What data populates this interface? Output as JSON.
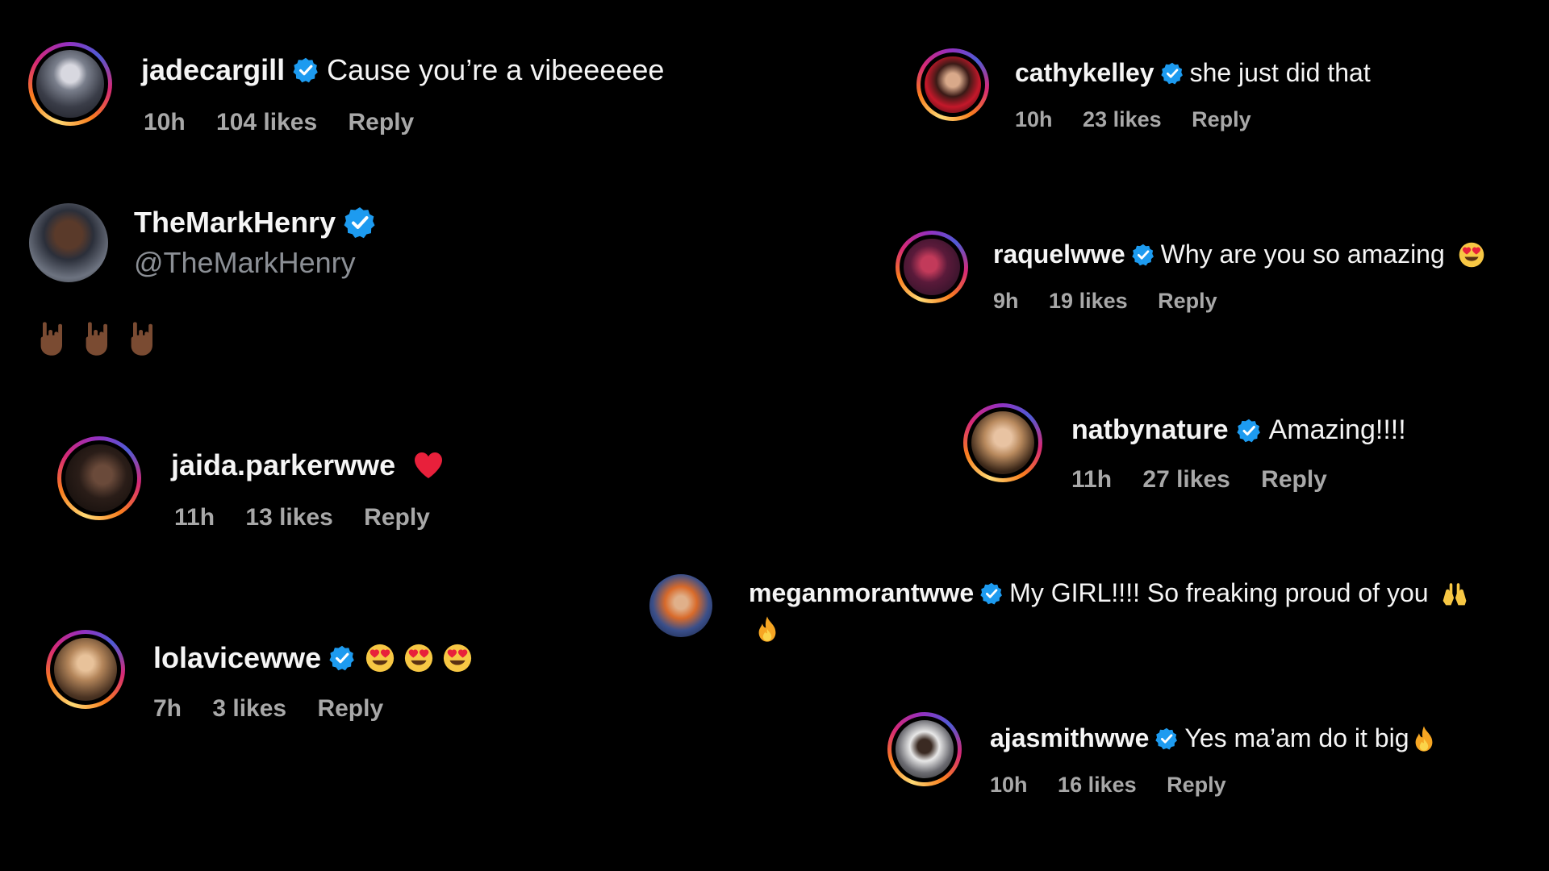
{
  "comments": [
    {
      "user": "jadecargill",
      "text": "Cause you’re a vibeeeeee",
      "time": "10h",
      "likes": "104 likes",
      "reply": "Reply"
    },
    {
      "user": "cathykelley",
      "text": "she just did that",
      "time": "10h",
      "likes": "23 likes",
      "reply": "Reply"
    },
    {
      "user": "raquelwwe",
      "text": "Why are you so amazing",
      "time": "9h",
      "likes": "19 likes",
      "reply": "Reply"
    },
    {
      "user": "natbynature",
      "text": "Amazing!!!!",
      "time": "11h",
      "likes": "27 likes",
      "reply": "Reply"
    },
    {
      "user": "jaida.parkerwwe",
      "text": "",
      "time": "11h",
      "likes": "13 likes",
      "reply": "Reply"
    },
    {
      "user": "meganmorantwwe",
      "text": "My GIRL!!!! So freaking proud of you",
      "time": "",
      "likes": "",
      "reply": ""
    },
    {
      "user": "lolavicewwe",
      "text": "",
      "time": "7h",
      "likes": "3 likes",
      "reply": "Reply"
    },
    {
      "user": "ajasmithwwe",
      "text": "Yes ma’am do it big",
      "time": "10h",
      "likes": "16 likes",
      "reply": "Reply"
    }
  ],
  "tweet": {
    "name": "TheMarkHenry",
    "handle": "@TheMarkHenry"
  },
  "icons": {
    "verified": "verified-badge-icon",
    "heart": "red-heart-emoji",
    "heart_eyes": "heart-eyes-emoji",
    "fire": "fire-emoji",
    "raised_hands": "raised-hands-emoji",
    "horns": "sign-of-the-horns-emoji"
  },
  "colors": {
    "background": "#000000",
    "verified": "#1d9bf0",
    "meta": "#a8a8a8",
    "text": "#f5f5f5"
  }
}
